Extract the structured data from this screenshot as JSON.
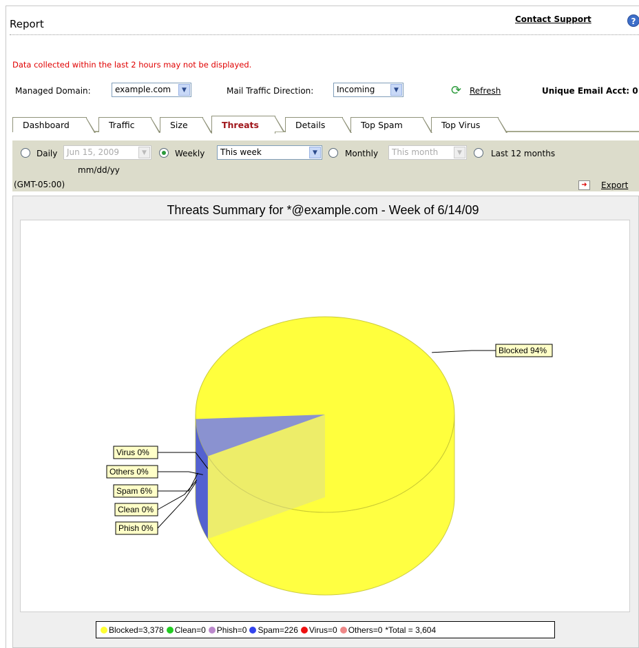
{
  "header": {
    "title": "Report",
    "contact_support": "Contact Support",
    "help": "?"
  },
  "warning": "Data collected within the last 2 hours may not be displayed.",
  "controls": {
    "managed_domain_label": "Managed Domain:",
    "managed_domain_value": "example.com",
    "mail_direction_label": "Mail Traffic Direction:",
    "mail_direction_value": "Incoming",
    "refresh": "Refresh",
    "unique_label": "Unique Email Acct: 0"
  },
  "tabs": [
    {
      "label": "Dashboard"
    },
    {
      "label": "Traffic"
    },
    {
      "label": "Size"
    },
    {
      "label": "Threats",
      "active": true
    },
    {
      "label": "Details"
    },
    {
      "label": "Top Spam"
    },
    {
      "label": "Top Virus"
    }
  ],
  "filters": {
    "daily_label": "Daily",
    "daily_value": "Jun 15, 2009",
    "date_format": "mm/dd/yy",
    "weekly_label": "Weekly",
    "weekly_value": "This week",
    "monthly_label": "Monthly",
    "monthly_value": "This month",
    "last12_label": "Last 12 months",
    "timezone": "(GMT-05:00)",
    "export": "Export",
    "selected": "weekly"
  },
  "chart_data": {
    "type": "pie",
    "title": "Threats Summary for *@example.com  - Week of 6/14/09",
    "series": [
      {
        "name": "Blocked",
        "value": 3378,
        "percent_label": "Blocked 94%",
        "color": "#ffff33"
      },
      {
        "name": "Clean",
        "value": 0,
        "percent_label": "Clean 0%",
        "color": "#22cc22"
      },
      {
        "name": "Phish",
        "value": 0,
        "percent_label": "Phish 0%",
        "color": "#bb88cc"
      },
      {
        "name": "Spam",
        "value": 226,
        "percent_label": "Spam 6%",
        "color": "#3344ee"
      },
      {
        "name": "Virus",
        "value": 0,
        "percent_label": "Virus 0%",
        "color": "#ee1111"
      },
      {
        "name": "Others",
        "value": 0,
        "percent_label": "Others 0%",
        "color": "#ee8888"
      }
    ],
    "legend": [
      {
        "text": "Blocked=3,378",
        "color": "#ffff33"
      },
      {
        "text": "Clean=0",
        "color": "#22cc22"
      },
      {
        "text": "Phish=0",
        "color": "#bb88cc"
      },
      {
        "text": "Spam=226",
        "color": "#3344ee"
      },
      {
        "text": "Virus=0",
        "color": "#ee1111"
      },
      {
        "text": "Others=0",
        "color": "#ee8888"
      }
    ],
    "total_text": "*Total = 3,604"
  }
}
